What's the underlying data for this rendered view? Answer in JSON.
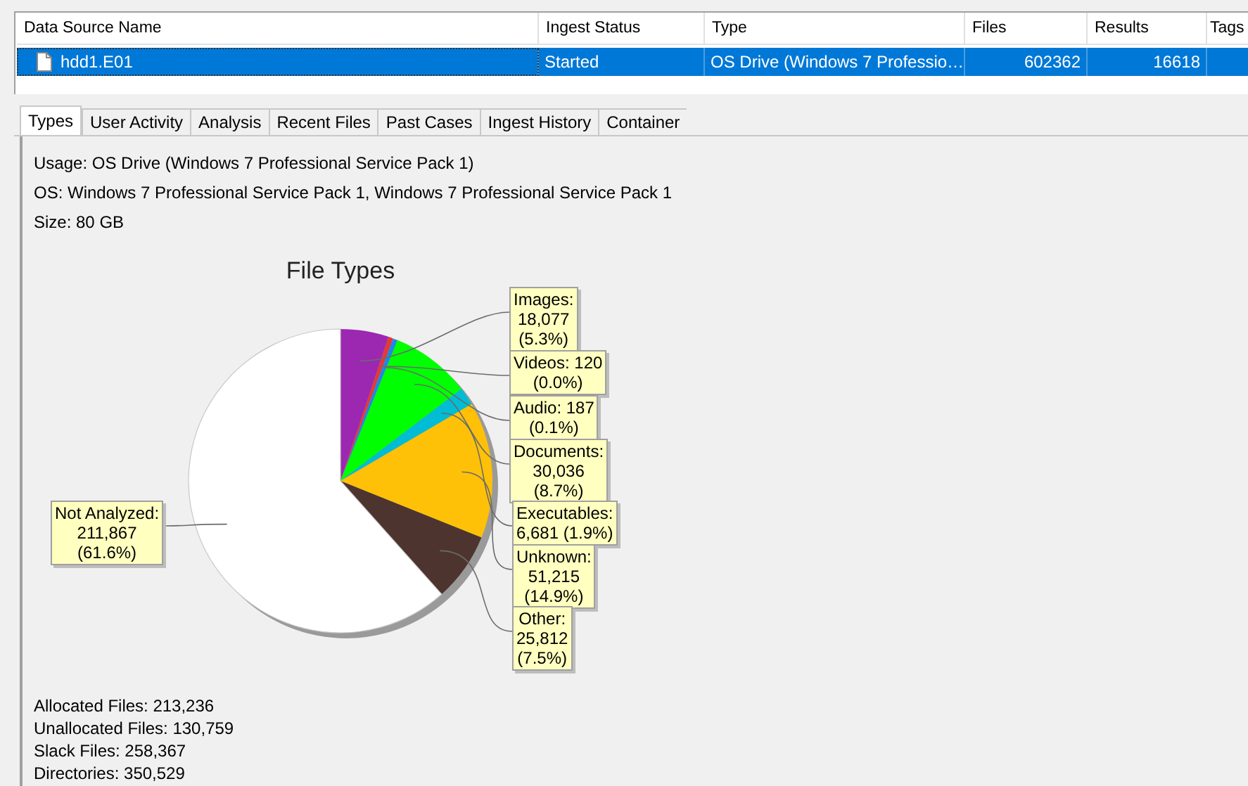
{
  "table": {
    "columns": [
      "Data Source Name",
      "Ingest Status",
      "Type",
      "Files",
      "Results",
      "Tags"
    ],
    "rows": [
      {
        "selected": true,
        "cells": [
          "hdd1.E01",
          "Started",
          "OS Drive (Windows 7 Professio…",
          "602362",
          "16618",
          ""
        ]
      }
    ]
  },
  "tabs": [
    {
      "label": "Types",
      "selected": true
    },
    {
      "label": "User Activity",
      "selected": false
    },
    {
      "label": "Analysis",
      "selected": false
    },
    {
      "label": "Recent Files",
      "selected": false
    },
    {
      "label": "Past Cases",
      "selected": false
    },
    {
      "label": "Ingest History",
      "selected": false
    },
    {
      "label": "Container",
      "selected": false
    }
  ],
  "details": [
    "Usage: OS Drive (Windows 7 Professional Service Pack 1)",
    "OS: Windows 7 Professional Service Pack 1, Windows 7 Professional Service Pack 1",
    "Size: 80 GB"
  ],
  "chart_data": {
    "type": "pie",
    "title": "File Types",
    "categories": [
      "Images",
      "Videos",
      "Audio",
      "Documents",
      "Executables",
      "Unknown",
      "Other",
      "Not Analyzed"
    ],
    "values": [
      18077,
      120,
      187,
      30036,
      6681,
      51215,
      25812,
      211867
    ],
    "colors": [
      "#9c27b0",
      "#e53935",
      "#1e88e5",
      "#00ff00",
      "#00bcd4",
      "#ffc107",
      "#4e342e",
      "#ffffff"
    ],
    "value_labels": [
      ":\n18,077\n(5.3%)",
      ": 120\n(0.0%)",
      ": 187\n(0.1%)",
      ":\n30,036\n(8.7%)",
      ":\n6,681 (1.9%)",
      ":\n51,215\n(14.9%)",
      ":\n25,812\n(7.5%)",
      ":\n211,867\n(61.6%)"
    ]
  },
  "stats": [
    "Allocated Files: 213,236",
    "Unallocated Files: 130,759",
    "Slack Files: 258,367",
    "Directories: 350,529"
  ]
}
